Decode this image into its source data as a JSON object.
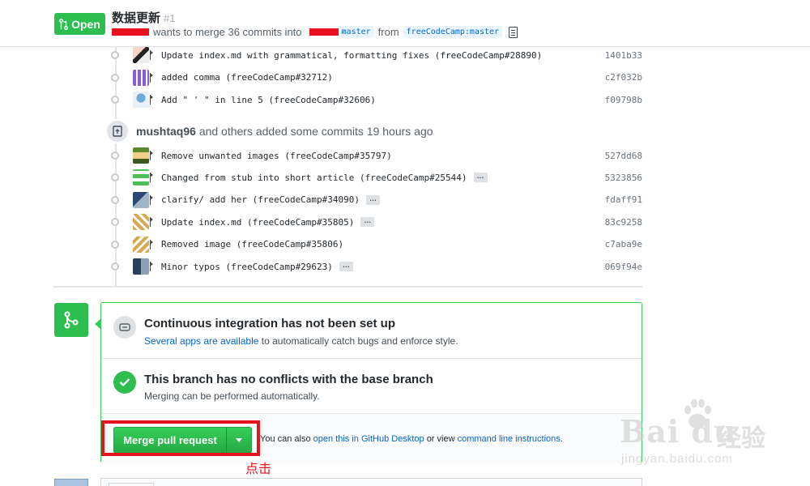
{
  "header": {
    "state": "Open",
    "title": "数据更新",
    "number": "#1",
    "meta_text": "wants to merge 36 commits into",
    "base_branch": "master",
    "from_text": "from",
    "head_branch": "freeCodeCamp:master"
  },
  "commits_top": [
    {
      "message": "Update index.md with grammatical, formatting fixes (freeCodeCamp#28890)",
      "sha": "1401b33",
      "has_ellipsis": false
    },
    {
      "message": "added comma (freeCodeCamp#32712)",
      "sha": "c2f032b",
      "has_ellipsis": false
    },
    {
      "message": "Add \" ' \" in line 5 (freeCodeCamp#32606)",
      "sha": "f09798b",
      "has_ellipsis": false
    }
  ],
  "event": {
    "user": "mushtaq96",
    "text": "and others added some commits 19 hours ago"
  },
  "commits_bottom": [
    {
      "message": "Remove unwanted images (freeCodeCamp#35797)",
      "sha": "527dd68",
      "has_ellipsis": false
    },
    {
      "message": "Changed from stub into short article (freeCodeCamp#25544)",
      "sha": "5323856",
      "has_ellipsis": true
    },
    {
      "message": "clarify/ add her (freeCodeCamp#34090)",
      "sha": "fdaff91",
      "has_ellipsis": true
    },
    {
      "message": "Update index.md (freeCodeCamp#35805)",
      "sha": "83c9258",
      "has_ellipsis": true
    },
    {
      "message": "Removed image (freeCodeCamp#35806)",
      "sha": "c7aba9e",
      "has_ellipsis": false
    },
    {
      "message": "Minor typos (freeCodeCamp#29623)",
      "sha": "069f94e",
      "has_ellipsis": true
    }
  ],
  "ellipsis": "…",
  "merge": {
    "ci_title": "Continuous integration has not been set up",
    "ci_link": "Several apps are available",
    "ci_rest": "to automatically catch bugs and enforce style.",
    "conflict_title": "This branch has no conflicts with the base branch",
    "conflict_sub": "Merging can be performed automatically.",
    "button_label": "Merge pull request",
    "hint_prefix": "You can also",
    "hint_link1": "open this in GitHub Desktop",
    "hint_mid": "or view",
    "hint_link2": "command line instructions",
    "hint_end": "."
  },
  "annotation": "点击",
  "watermark": {
    "brand": "Bai du",
    "cn": "经验",
    "url": "jingyan.baidu.com"
  },
  "colors": {
    "green": "#2cbe4e",
    "link": "#0366d6",
    "highlight": "#e8121e"
  }
}
